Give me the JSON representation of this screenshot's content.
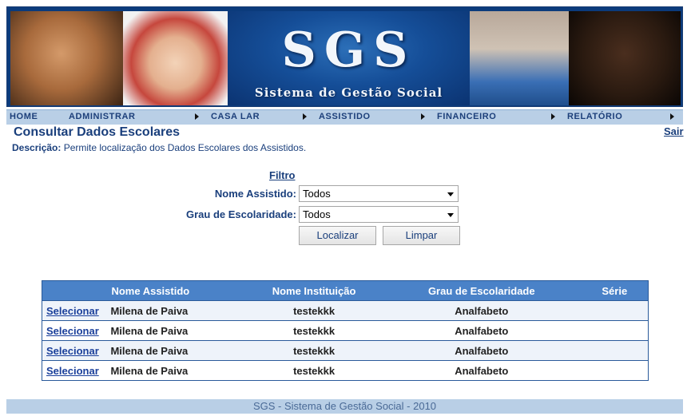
{
  "banner": {
    "logo_text": "SGS",
    "subtitle": "Sistema de Gestão Social"
  },
  "nav": {
    "items": [
      {
        "label": "HOME"
      },
      {
        "label": "ADMINISTRAR"
      },
      {
        "label": "CASA LAR"
      },
      {
        "label": "ASSISTIDO"
      },
      {
        "label": "FINANCEIRO"
      },
      {
        "label": "RELATÓRIO"
      }
    ]
  },
  "page": {
    "title": "Consultar Dados Escolares",
    "logout": "Sair",
    "description_label": "Descrição:",
    "description_text": " Permite localização dos Dados Escolares dos Assistidos."
  },
  "filter": {
    "title": "Filtro",
    "nome_label": "Nome Assistido:",
    "nome_value": "Todos",
    "grau_label": "Grau de Escolaridade:",
    "grau_value": "Todos",
    "search_button": "Localizar",
    "clear_button": "Limpar"
  },
  "table": {
    "headers": [
      "",
      "Nome Assistido",
      "Nome Instituição",
      "Grau de Escolaridade",
      "Série"
    ],
    "rows": [
      {
        "action": "Selecionar",
        "nome": "Milena de Paiva",
        "instituicao": "testekkk",
        "grau": "Analfabeto",
        "serie": ""
      },
      {
        "action": "Selecionar",
        "nome": "Milena de Paiva",
        "instituicao": "testekkk",
        "grau": "Analfabeto",
        "serie": ""
      },
      {
        "action": "Selecionar",
        "nome": "Milena de Paiva",
        "instituicao": "testekkk",
        "grau": "Analfabeto",
        "serie": ""
      },
      {
        "action": "Selecionar",
        "nome": "Milena de Paiva",
        "instituicao": "testekkk",
        "grau": "Analfabeto",
        "serie": ""
      }
    ]
  },
  "footer": {
    "text": "SGS - Sistema de Gestão Social - 2010"
  },
  "colors": {
    "brand_blue": "#1a3f7c",
    "nav_bg": "#b9cfe6",
    "table_header": "#4a82c8"
  }
}
